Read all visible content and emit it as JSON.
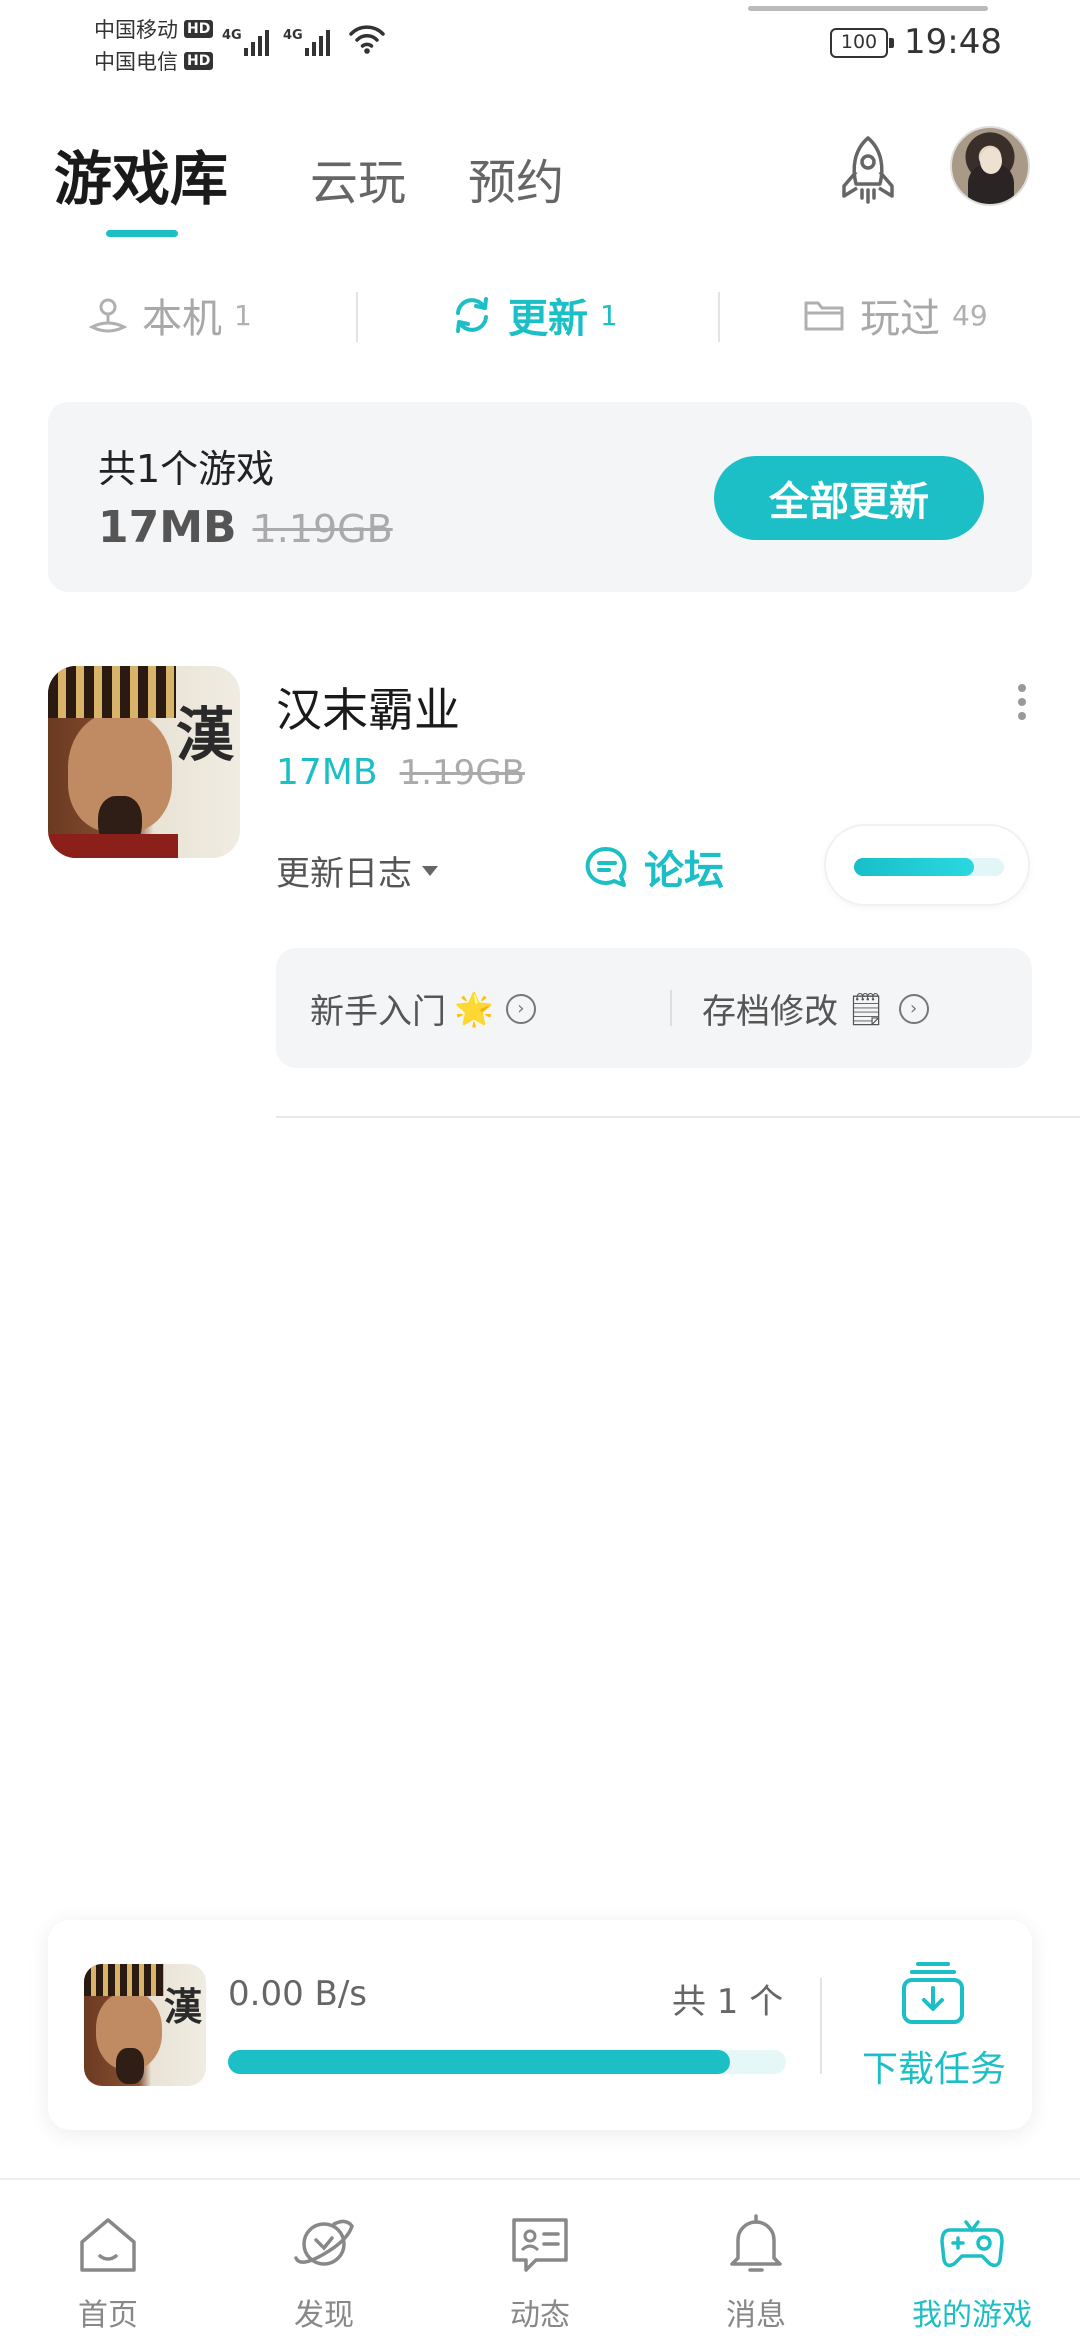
{
  "status_bar": {
    "carrier1": "中国移动",
    "carrier2": "中国电信",
    "hd_badge": "HD",
    "network_tag": "4G",
    "battery": "100",
    "time": "19:48"
  },
  "header": {
    "tabs": [
      {
        "label": "游戏库",
        "active": true
      },
      {
        "label": "云玩",
        "active": false
      },
      {
        "label": "预约",
        "active": false
      }
    ],
    "rocket_icon": "rocket-icon",
    "avatar_icon": "user-avatar"
  },
  "sub_tabs": [
    {
      "label": "本机",
      "count": "1",
      "icon": "phone-stand-icon",
      "active": false
    },
    {
      "label": "更新",
      "count": "1",
      "icon": "refresh-icon",
      "active": true
    },
    {
      "label": "玩过",
      "count": "49",
      "icon": "folder-icon",
      "active": false
    }
  ],
  "summary": {
    "title": "共1个游戏",
    "size": "17MB",
    "original_size": "1.19GB",
    "update_all_label": "全部更新"
  },
  "game": {
    "name": "汉末霸业",
    "icon_glyph": "漢",
    "size": "17MB",
    "original_size": "1.19GB",
    "changelog_label": "更新日志",
    "forum_label": "论坛",
    "progress_fraction": 0.8,
    "guides": [
      {
        "label": "新手入门",
        "emoji": "🌟"
      },
      {
        "label": "存档修改",
        "emoji": "🗒"
      }
    ],
    "chevron": "›"
  },
  "download": {
    "speed": "0.00 B/s",
    "total": "共 1 个",
    "progress_fraction": 0.9,
    "tasks_label": "下载任务"
  },
  "bottom_nav": [
    {
      "label": "首页",
      "icon": "home-icon",
      "active": false
    },
    {
      "label": "发现",
      "icon": "planet-icon",
      "active": false
    },
    {
      "label": "动态",
      "icon": "feed-icon",
      "active": false
    },
    {
      "label": "消息",
      "icon": "bell-icon",
      "active": false
    },
    {
      "label": "我的游戏",
      "icon": "gamepad-icon",
      "active": true
    }
  ],
  "colors": {
    "accent": "#1dbfc6",
    "text_primary": "#1a1a1a",
    "text_muted": "#a8a8a8",
    "card_bg": "#f4f5f7"
  }
}
